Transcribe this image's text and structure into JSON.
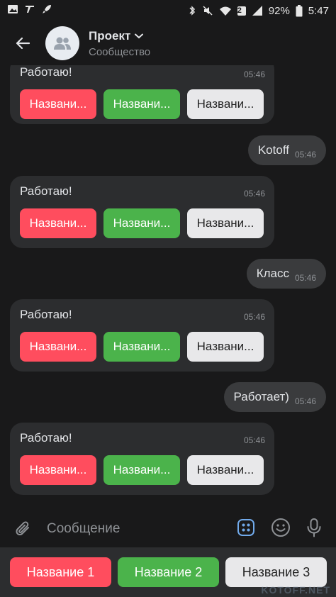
{
  "status_bar": {
    "battery_percent": "92%",
    "time": "5:47",
    "sim_badge": "2",
    "left_icons": [
      "gallery-icon",
      "airplane-icon",
      "rocket-icon"
    ],
    "right_icons": [
      "bluetooth-icon",
      "mute-icon",
      "wifi-icon",
      "signal-icon",
      "battery-icon"
    ]
  },
  "header": {
    "title": "Проект",
    "subtitle": "Сообщество"
  },
  "messages": [
    {
      "type": "in",
      "text": "Работаю!",
      "time": "05:46",
      "buttons": [
        "Названи...",
        "Названи...",
        "Названи..."
      ]
    },
    {
      "type": "out",
      "text": "Kotoff",
      "time": "05:46"
    },
    {
      "type": "in",
      "text": "Работаю!",
      "time": "05:46",
      "buttons": [
        "Названи...",
        "Названи...",
        "Названи..."
      ]
    },
    {
      "type": "out",
      "text": "Класс",
      "time": "05:46"
    },
    {
      "type": "in",
      "text": "Работаю!",
      "time": "05:46",
      "buttons": [
        "Названи...",
        "Названи...",
        "Названи..."
      ]
    },
    {
      "type": "out",
      "text": "Работает)",
      "time": "05:46"
    },
    {
      "type": "in",
      "text": "Работаю!",
      "time": "05:46",
      "buttons": [
        "Названи...",
        "Названи...",
        "Названи..."
      ]
    }
  ],
  "composer": {
    "placeholder": "Сообщение"
  },
  "keyboard": {
    "buttons": [
      "Название 1",
      "Название 2",
      "Название 3"
    ]
  },
  "watermark": "KOTOFF.NET",
  "colors": {
    "background": "#19191a",
    "bubble_in": "#2c2d2f",
    "bubble_out": "#3a3b3d",
    "negative": "#ff4d5e",
    "positive": "#4bb34b",
    "secondary": "#e8e8ea",
    "accent": "#71aaeb"
  }
}
